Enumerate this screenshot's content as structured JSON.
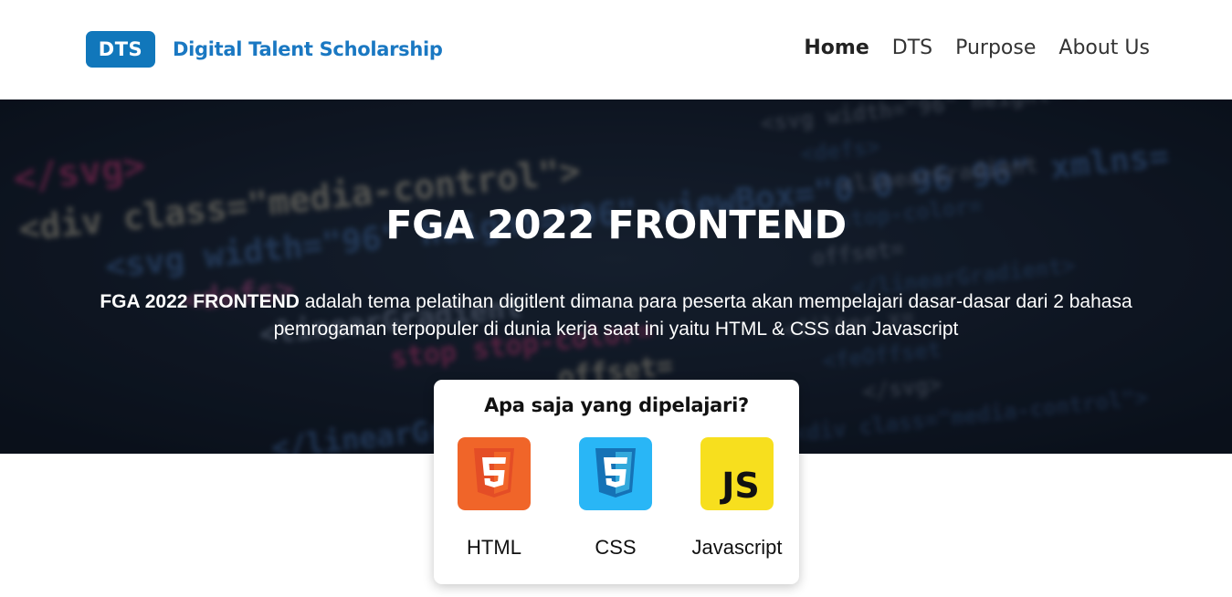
{
  "brand": {
    "badge": "DTS",
    "name": "Digital Talent Scholarship"
  },
  "nav": [
    {
      "label": "Home",
      "active": true
    },
    {
      "label": "DTS",
      "active": false
    },
    {
      "label": "Purpose",
      "active": false
    },
    {
      "label": "About Us",
      "active": false
    }
  ],
  "hero": {
    "title": "FGA 2022 FRONTEND",
    "desc_bold": "FGA 2022 FRONTEND",
    "desc_rest": " adalah tema pelatihan digitlent dimana para peserta akan mempelajari dasar-dasar dari 2 bahasa pemrogaman terpopuler di dunia kerja saat ini yaitu HTML & CSS dan Javascript",
    "background_code": [
      "</svg>",
      "<div class=\"media-control\">",
      "<svg width=\"96\" height=\"96\" viewBox=\"0 0 96 96\" xmlns=",
      "<defs>",
      "<linearGradient",
      "stop stop-color=",
      "offset=",
      "</linearGradient>",
      "<filter x=",
      "<feOffset"
    ]
  },
  "card": {
    "title": "Apa saja yang dipelajari?",
    "items": [
      {
        "label": "HTML",
        "icon": "html5-icon",
        "color": "#e44d26"
      },
      {
        "label": "CSS",
        "icon": "css3-icon",
        "color": "#1b9bd8"
      },
      {
        "label": "Javascript",
        "icon": "js-icon",
        "color": "#f7df1e"
      }
    ]
  },
  "colors": {
    "brand": "#1177bb",
    "hero_bg": "#121c2a"
  }
}
